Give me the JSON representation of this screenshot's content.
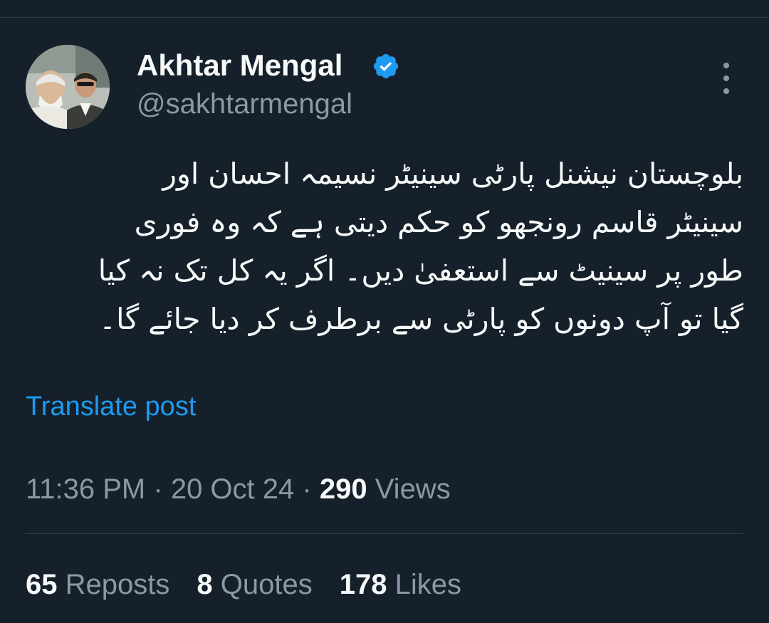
{
  "author": {
    "name": "Akhtar Mengal",
    "handle": "@sakhtarmengal",
    "verified": true
  },
  "post": {
    "lines": [
      "بلوچستان نیشنل پارٹی سینیٹر نسیمہ احسان اور",
      "سینیٹر قاسم رونجھو کو حکم دیتی ہے کہ وہ فوری",
      "طور پر سینیٹ سے استعفیٰ دیں۔ اگر یہ کل تک نہ کیا",
      "گیا تو آپ دونوں کو پارٹی سے برطرف کر دیا جائے گا۔"
    ],
    "translate_label": "Translate post"
  },
  "meta": {
    "time": "11:36 PM",
    "separator": "·",
    "date": "20 Oct 24",
    "views_count": "290",
    "views_label": "Views"
  },
  "stats": {
    "reposts_count": "65",
    "reposts_label": "Reposts",
    "quotes_count": "8",
    "quotes_label": "Quotes",
    "likes_count": "178",
    "likes_label": "Likes"
  },
  "icons": {
    "verified": "verified-badge-icon",
    "more": "more-options-icon"
  },
  "colors": {
    "background": "#15202b",
    "text_primary": "#f7f9f9",
    "text_secondary": "#8b98a5",
    "accent": "#1d9bf0",
    "divider": "#2f3b47"
  }
}
